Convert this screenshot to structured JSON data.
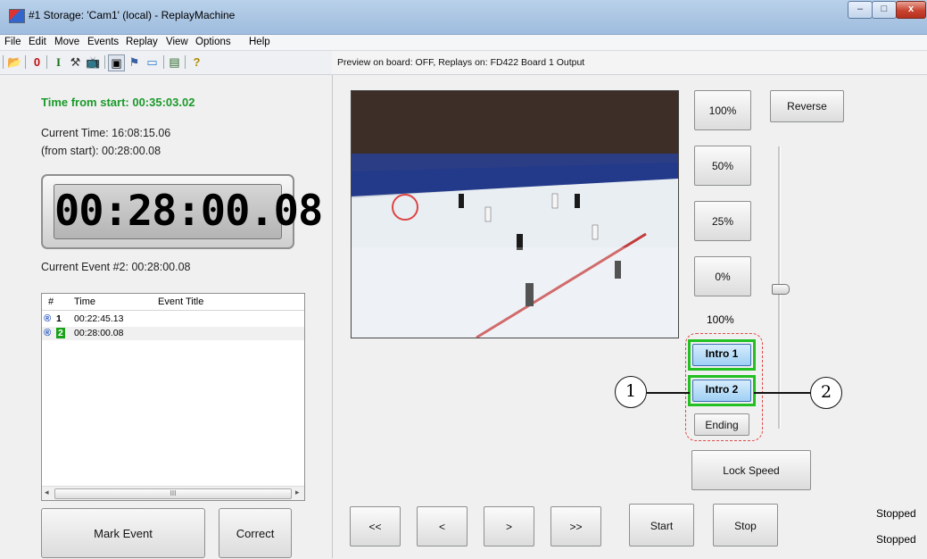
{
  "window": {
    "title": "#1 Storage: 'Cam1' (local) - ReplayMachine",
    "min_label": "–",
    "max_label": "□",
    "close_label": "x"
  },
  "menu": [
    "File",
    "Edit",
    "Move",
    "Events",
    "Replay",
    "View",
    "Options",
    "Help"
  ],
  "toolbar": {
    "icons": [
      "open-folder-icon",
      "zero-icon",
      "i-icon",
      "tools-icon",
      "tv-icon",
      "video-icon",
      "flag-icon",
      "monitor-icon",
      "list-icon",
      "help-icon"
    ],
    "glyphs": [
      "📂",
      "0",
      "I",
      "⚒",
      "📺",
      "▣",
      "⚑",
      "▭",
      "▤",
      "?"
    ]
  },
  "status": "Preview on board: OFF, Replays on: FD422 Board 1 Output",
  "left": {
    "time_from_start": "Time from start: 00:35:03.02",
    "current_time": "Current Time: 16:08:15.06",
    "from_start": "(from start): 00:28:00.08",
    "clock": "00:28:00.08",
    "current_event": "Current Event #2: 00:28:00.08",
    "table": {
      "headers": [
        "#",
        "Time",
        "Event Title"
      ],
      "rows": [
        {
          "icon": "®",
          "num": "1",
          "time": "00:22:45.13",
          "title": ""
        },
        {
          "icon": "®",
          "num": "2",
          "time": "00:28:00.08",
          "title": ""
        }
      ],
      "scroll_left": "◂",
      "scroll_right": "▸",
      "thumb": "III"
    },
    "mark_event": "Mark Event",
    "correct": "Correct"
  },
  "right": {
    "speed_buttons": [
      "100%",
      "50%",
      "25%",
      "0%"
    ],
    "reverse": "Reverse",
    "speed_readout": "100%",
    "intro1": "Intro 1",
    "intro2": "Intro 2",
    "ending": "Ending",
    "lock_speed": "Lock Speed",
    "nav": [
      "<<",
      "<",
      ">",
      ">>"
    ],
    "start": "Start",
    "stop": "Stop",
    "state1": "Stopped",
    "state2": "Stopped",
    "callout1": "1",
    "callout2": "2"
  },
  "colors": {
    "green_text": "#1a9a2a",
    "highlight_green": "#22c022",
    "dashed_red": "#e04a4a"
  }
}
